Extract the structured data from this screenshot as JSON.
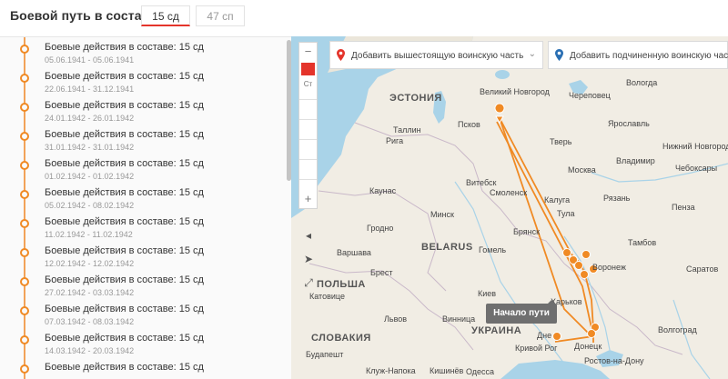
{
  "header": {
    "title": "Боевой путь в составе:",
    "tabs": [
      {
        "label": "15 сд",
        "active": true
      },
      {
        "label": "47 сп",
        "active": false
      }
    ]
  },
  "sidebar": {
    "items": [
      {
        "title": "Боевые действия в составе: 15 сд",
        "dates": "05.06.1941 - 05.06.1941"
      },
      {
        "title": "Боевые действия в составе: 15 сд",
        "dates": "22.06.1941 - 31.12.1941"
      },
      {
        "title": "Боевые действия в составе: 15 сд",
        "dates": "24.01.1942 - 26.01.1942"
      },
      {
        "title": "Боевые действия в составе: 15 сд",
        "dates": "31.01.1942 - 31.01.1942"
      },
      {
        "title": "Боевые действия в составе: 15 сд",
        "dates": "01.02.1942 - 01.02.1942"
      },
      {
        "title": "Боевые действия в составе: 15 сд",
        "dates": "05.02.1942 - 08.02.1942"
      },
      {
        "title": "Боевые действия в составе: 15 сд",
        "dates": "11.02.1942 - 11.02.1942"
      },
      {
        "title": "Боевые действия в составе: 15 сд",
        "dates": "12.02.1942 - 12.02.1942"
      },
      {
        "title": "Боевые действия в составе: 15 сд",
        "dates": "27.02.1942 - 03.03.1942"
      },
      {
        "title": "Боевые действия в составе: 15 сд",
        "dates": "07.03.1942 - 08.03.1942"
      },
      {
        "title": "Боевые действия в составе: 15 сд",
        "dates": "14.03.1942 - 20.03.1942"
      },
      {
        "title": "Боевые действия в составе: 15 сд",
        "dates": ""
      }
    ]
  },
  "map": {
    "dropdown_up": "Добавить вышестоящую воинскую часть",
    "dropdown_down": "Добавить подчиненную воинскую часть",
    "tooltip": "Начало пути",
    "zoom_in": "+",
    "zoom_out": "−",
    "layer_label": "Ст",
    "labels": {
      "tallinn": "Таллин",
      "estonia": "ЭСТОНИЯ",
      "velikiy_novgorod": "Великий Новгород",
      "cherepovets": "Череповец",
      "vologda": "Вологда",
      "pskov": "Псков",
      "yaroslavl": "Ярославль",
      "riga": "Рига",
      "tver": "Тверь",
      "nizhniy_novgorod": "Нижний Новгород",
      "vladimir": "Владимир",
      "moskva": "Москва",
      "cheboksary": "Чебоксары",
      "vitebsk": "Витебск",
      "smolensk": "Смоленск",
      "kaunas": "Каунас",
      "ryazan": "Рязань",
      "minsk": "Минск",
      "kaluga": "Калуга",
      "tula": "Тула",
      "penza": "Пенза",
      "grodno": "Гродно",
      "tambov": "Тамбов",
      "bryansk": "Брянск",
      "gomel": "Гомель",
      "belarus": "BELARUS",
      "varshava": "Варшава",
      "voronezh": "Воронеж",
      "saratov": "Саратов",
      "brest": "Брест",
      "polsha": "ПОЛЬША",
      "katovice": "Катовице",
      "kiev": "Киев",
      "kharkov": "Харьков",
      "lvov": "Львов",
      "vinnitsa": "Винница",
      "ukraina": "УКРАИНА",
      "volgograd": "Волгоград",
      "slovakia": "СЛОВАКИЯ",
      "dnepr": "Дне",
      "donetsk": "Донецк",
      "budapesht": "Будапешт",
      "krivoy_rog": "Кривой Рог",
      "rostov": "Ростов-на-Дону",
      "klui_napoka": "Клуж-Напока",
      "kishinev": "Кишинёв",
      "odessa": "Одесса"
    }
  },
  "colors": {
    "accent": "#e4342b",
    "route": "#f08a24",
    "water": "#a9d3e8",
    "land": "#f1ede4"
  },
  "icons": {
    "pin_up": "pin-red-icon",
    "pin_down": "pin-blue-icon",
    "chevron": "chevron-down-icon",
    "navigate": "navigate-arrow-icon",
    "fullscreen": "fullscreen-icon",
    "collapse": "collapse-left-icon",
    "route_marker": "route-marker-icon"
  }
}
